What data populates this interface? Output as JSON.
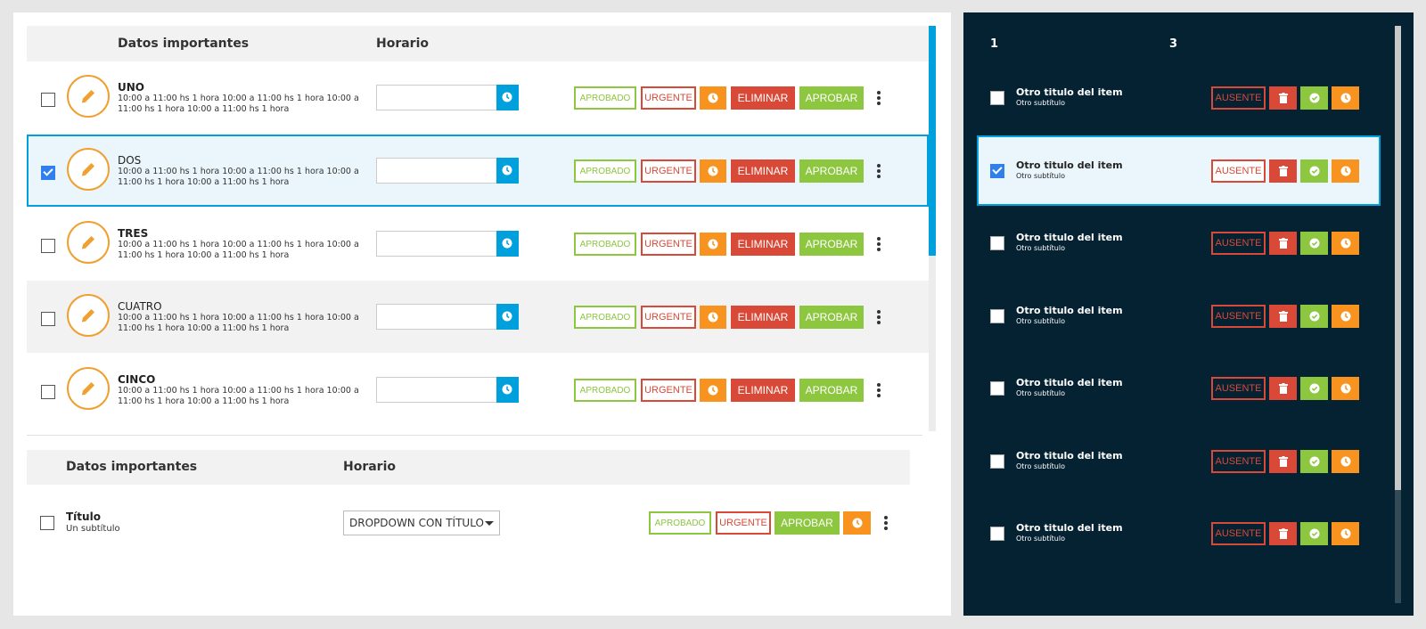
{
  "main_list": {
    "headers": {
      "data": "Datos importantes",
      "schedule": "Horario"
    },
    "rows": [
      {
        "title": "UNO",
        "desc": "10:00 a 11:00 hs 1 hora 10:00 a 11:00 hs 1 hora 10:00 a 11:00 hs 1 hora 10:00 a 11:00 hs 1 hora",
        "checked": false
      },
      {
        "title": "DOS",
        "desc": "10:00 a 11:00 hs 1 hora 10:00 a 11:00 hs 1 hora 10:00 a 11:00 hs 1 hora 10:00 a 11:00 hs 1 hora",
        "checked": true
      },
      {
        "title": "TRES",
        "desc": "10:00 a 11:00 hs 1 hora 10:00 a 11:00 hs 1 hora 10:00 a 11:00 hs 1 hora 10:00 a 11:00 hs 1 hora",
        "checked": false
      },
      {
        "title": "CUATRO",
        "desc": "10:00 a 11:00 hs 1 hora 10:00 a 11:00 hs 1 hora 10:00 a 11:00 hs 1 hora 10:00 a 11:00 hs 1 hora",
        "checked": false
      },
      {
        "title": "CINCO",
        "desc": "10:00 a 11:00 hs 1 hora 10:00 a 11:00 hs 1 hora 10:00 a 11:00 hs 1 hora 10:00 a 11:00 hs 1 hora",
        "checked": false
      }
    ],
    "buttons": {
      "approved": "APROBADO",
      "urgent": "URGENTE",
      "delete": "ELIMINAR",
      "approve": "APROBAR"
    }
  },
  "second_list": {
    "headers": {
      "data": "Datos importantes",
      "schedule": "Horario"
    },
    "row": {
      "title": "Título",
      "subtitle": "Un subtítulo",
      "dropdown_value": "DROPDOWN CON TÍTULO"
    },
    "buttons": {
      "approved": "APROBADO",
      "urgent": "URGENTE",
      "approve": "APROBAR"
    }
  },
  "side_list": {
    "headers": {
      "col1": "1",
      "col3": "3"
    },
    "rows": [
      {
        "title": "Otro titulo del item",
        "subtitle": "Otro subtítulo",
        "checked": false
      },
      {
        "title": "Otro titulo del item",
        "subtitle": "Otro subtítulo",
        "checked": true
      },
      {
        "title": "Otro titulo del item",
        "subtitle": "Otro subtítulo",
        "checked": false
      },
      {
        "title": "Otro titulo del item",
        "subtitle": "Otro subtítulo",
        "checked": false
      },
      {
        "title": "Otro titulo del item",
        "subtitle": "Otro subtítulo",
        "checked": false
      },
      {
        "title": "Otro titulo del item",
        "subtitle": "Otro subtítulo",
        "checked": false
      },
      {
        "title": "Otro titulo del item",
        "subtitle": "Otro subtítulo",
        "checked": false
      }
    ],
    "buttons": {
      "absent": "AUSENTE"
    }
  },
  "icons": {
    "edit": "pencil-icon",
    "time": "clock-icon",
    "delete": "trash-icon",
    "confirm": "check-circle-icon",
    "more": "kebab-icon"
  },
  "colors": {
    "primary": "#00a0dc",
    "approved": "#8dc63f",
    "danger": "#d94937",
    "warning": "#f7931e",
    "edit_accent": "#f0a030",
    "dark_panel": "#052233"
  }
}
